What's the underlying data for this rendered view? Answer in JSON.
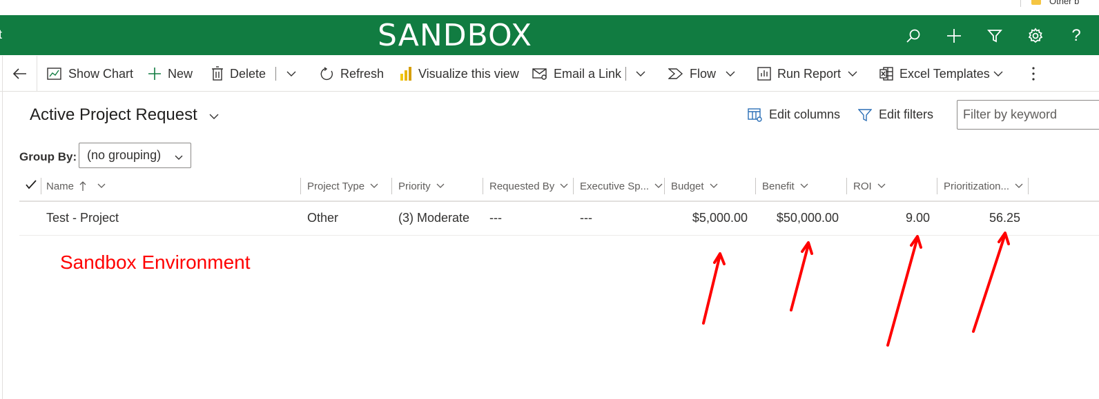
{
  "browser": {
    "bookmark_label": "Other b"
  },
  "header": {
    "left_text": "t",
    "title": "SANDBOX",
    "background": "#117c41",
    "icons": [
      "search-icon",
      "add-icon",
      "filter-icon",
      "settings-icon",
      "help-icon"
    ],
    "help_glyph": "?"
  },
  "commandbar": {
    "show_chart": "Show Chart",
    "new": "New",
    "delete": "Delete",
    "refresh": "Refresh",
    "visualize": "Visualize this view",
    "email_link": "Email a Link",
    "flow": "Flow",
    "run_report": "Run Report",
    "excel_templates": "Excel Templates"
  },
  "view": {
    "title": "Active Project Request",
    "edit_columns": "Edit columns",
    "edit_filters": "Edit filters",
    "filter_placeholder": "Filter by keyword",
    "group_by_label": "Group By:",
    "group_by_value": "(no grouping)"
  },
  "grid": {
    "columns": [
      "Name",
      "Project Type",
      "Priority",
      "Requested By",
      "Executive Sp...",
      "Budget",
      "Benefit",
      "ROI",
      "Prioritization..."
    ],
    "rows": [
      {
        "name": "Test - Project",
        "project_type": "Other",
        "priority": "(3) Moderate",
        "requested_by": "---",
        "executive_sponsor": "---",
        "budget": "$5,000.00",
        "benefit": "$50,000.00",
        "roi": "9.00",
        "prioritization": "56.25"
      }
    ]
  },
  "annotation": {
    "text": "Sandbox Environment",
    "color": "#ff0000"
  }
}
